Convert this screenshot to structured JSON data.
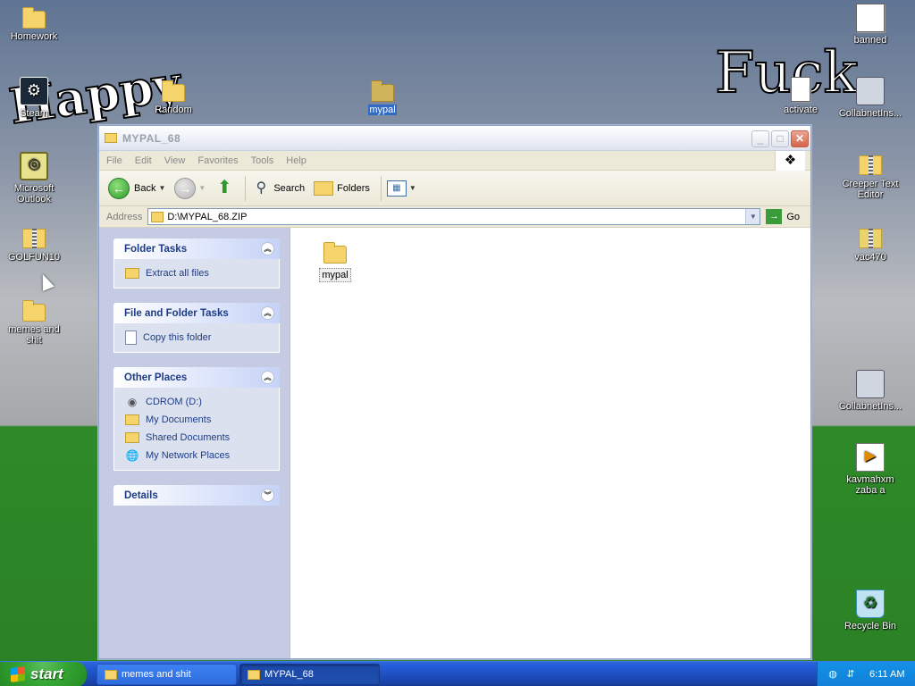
{
  "desktop": {
    "icons": [
      {
        "label": "Homework",
        "icon": "folder-icon"
      },
      {
        "label": "Steam",
        "icon": "steam-icon"
      },
      {
        "label": "Random",
        "icon": "folder-icon"
      },
      {
        "label": "mypal",
        "icon": "folder-icon"
      },
      {
        "label": "Microsoft Outlook",
        "icon": "outlook-icon"
      },
      {
        "label": "GOLFUN10",
        "icon": "zip-folder-icon"
      },
      {
        "label": "memes and shit",
        "icon": "folder-icon"
      },
      {
        "label": "banned",
        "icon": "document-icon"
      },
      {
        "label": "activate",
        "icon": "script-icon"
      },
      {
        "label": "CollabnetIns...",
        "icon": "computer-icon"
      },
      {
        "label": "Creeper Text Editor",
        "icon": "zip-folder-icon"
      },
      {
        "label": "vac470",
        "icon": "7zip-icon"
      },
      {
        "label": "CollabnetIns...",
        "icon": "computer-icon"
      },
      {
        "label": "kavmahxm zaba a",
        "icon": "media-file-icon"
      },
      {
        "label": "Recycle Bin",
        "icon": "recycle-bin-icon"
      }
    ]
  },
  "window": {
    "title": "MYPAL_68",
    "menu": [
      "File",
      "Edit",
      "View",
      "Favorites",
      "Tools",
      "Help"
    ],
    "toolbar": {
      "back": "Back",
      "search": "Search",
      "folders": "Folders"
    },
    "address": {
      "label": "Address",
      "value": "D:\\MYPAL_68.ZIP",
      "go": "Go"
    },
    "panes": {
      "folder_tasks": {
        "title": "Folder Tasks",
        "items": [
          "Extract all files"
        ]
      },
      "file_folder_tasks": {
        "title": "File and Folder Tasks",
        "items": [
          "Copy this folder"
        ]
      },
      "other_places": {
        "title": "Other Places",
        "items": [
          "CDROM (D:)",
          "My Documents",
          "Shared Documents",
          "My Network Places"
        ]
      },
      "details": {
        "title": "Details"
      }
    },
    "content": {
      "items": [
        "mypal"
      ]
    }
  },
  "taskbar": {
    "start": "start",
    "tasks": [
      "memes and shit",
      "MYPAL_68"
    ],
    "clock": "6:11 AM"
  }
}
